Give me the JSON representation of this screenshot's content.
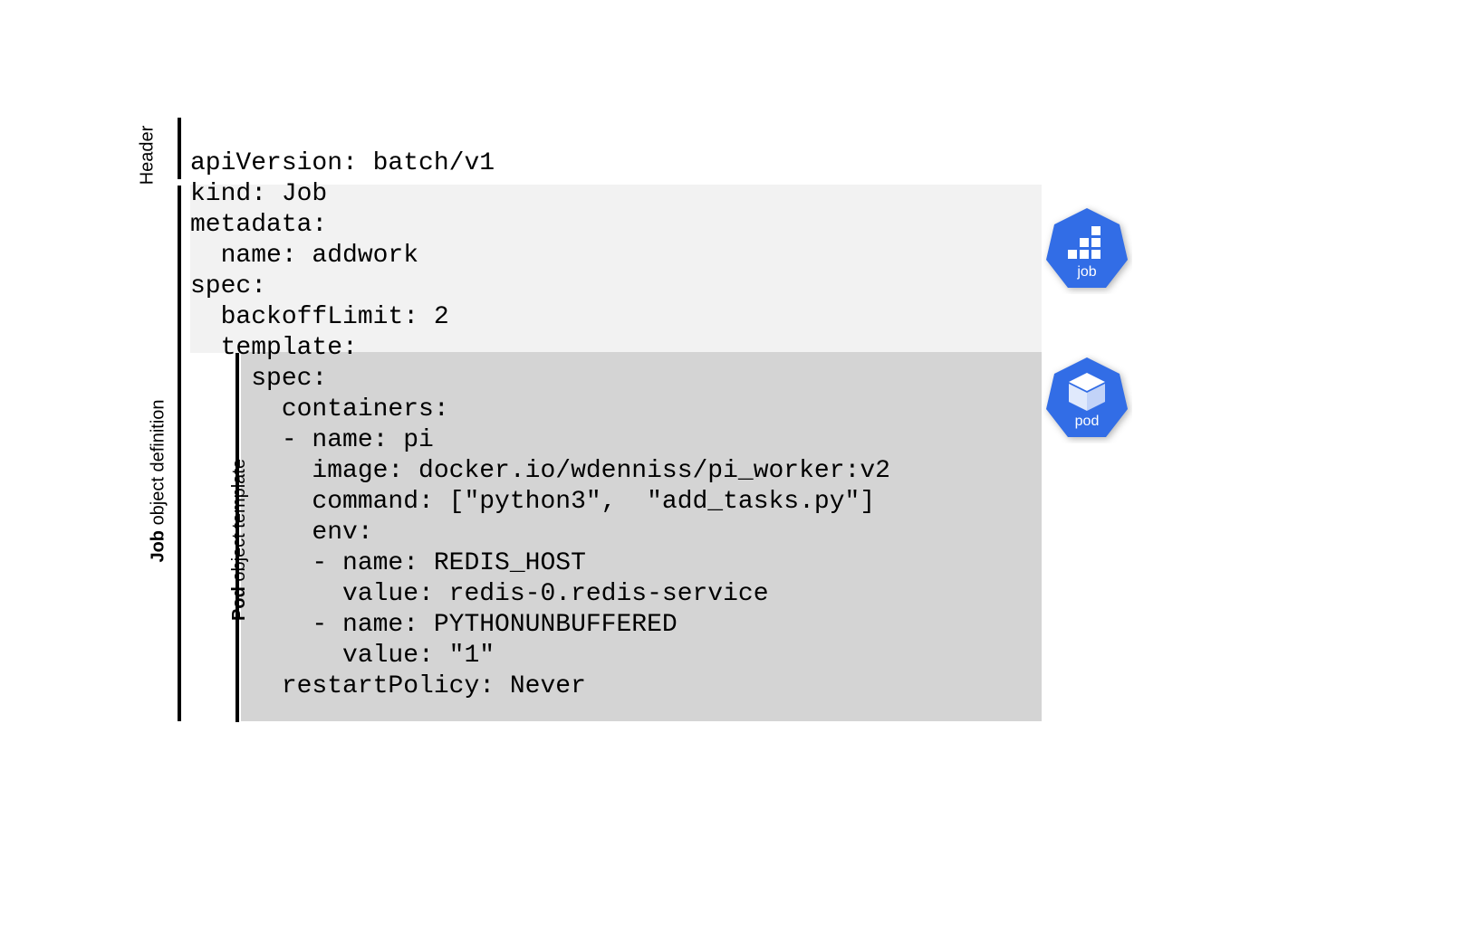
{
  "labels": {
    "header": "Header",
    "job_definition": "Job object definition",
    "pod_template": "Pod object template",
    "job_icon": "job",
    "pod_icon": "pod"
  },
  "code": {
    "line1": "apiVersion: batch/v1",
    "line2": "kind: Job",
    "line3": "metadata:",
    "line4": "  name: addwork",
    "line5": "spec:",
    "line6": "  backoffLimit: 2",
    "line7": "  template:",
    "line8": "    spec:",
    "line9": "      containers:",
    "line10": "      - name: pi",
    "line11": "        image: docker.io/wdenniss/pi_worker:v2",
    "line12": "        command: [\"python3\",  \"add_tasks.py\"]",
    "line13": "        env:",
    "line14": "        - name: REDIS_HOST",
    "line15": "          value: redis-0.redis-service",
    "line16": "        - name: PYTHONUNBUFFERED",
    "line17": "          value: \"1\"",
    "line18": "      restartPolicy: Never"
  }
}
